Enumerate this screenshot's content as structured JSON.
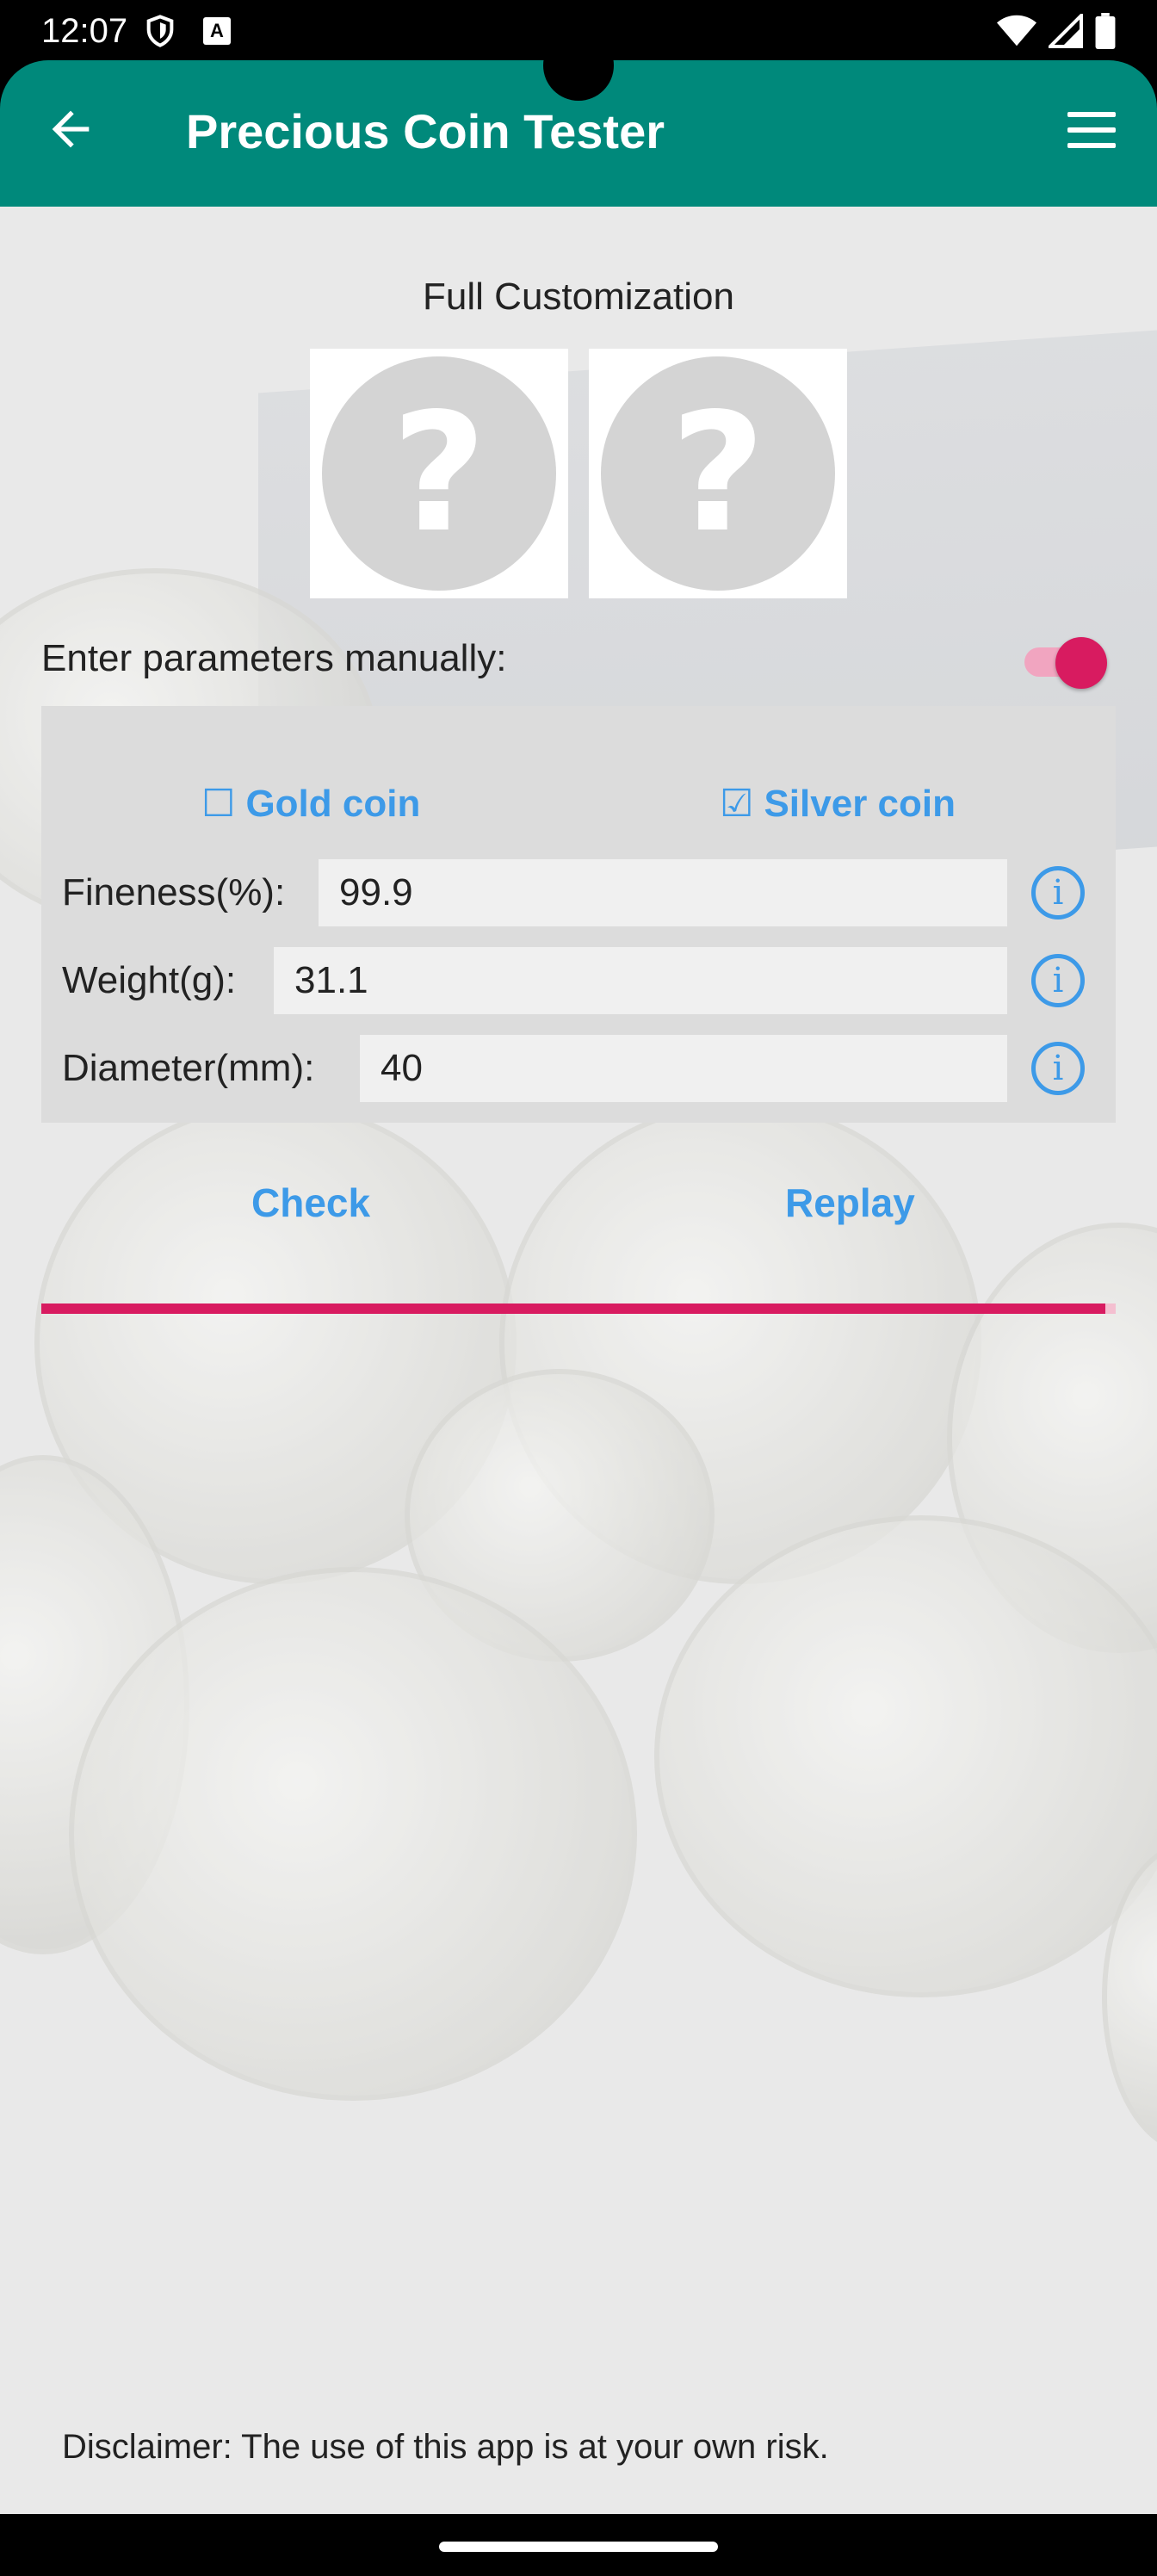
{
  "status_bar": {
    "time": "12:07",
    "keyboard_badge": "A"
  },
  "app_bar": {
    "title": "Precious Coin Tester",
    "accent_color": "#00897B"
  },
  "section": {
    "title": "Full Customization"
  },
  "coin_images": [
    {
      "glyph": "?"
    },
    {
      "glyph": "?"
    }
  ],
  "manual": {
    "label": "Enter parameters manually:",
    "enabled": true
  },
  "coin_types": {
    "gold": {
      "label": "Gold coin",
      "checkbox": "☐",
      "checked": false
    },
    "silver": {
      "label": "Silver coin",
      "checkbox": "☑",
      "checked": true
    }
  },
  "fields": {
    "fineness": {
      "label": "Fineness(%):",
      "value": "99.9"
    },
    "weight": {
      "label": "Weight(g):",
      "value": "31.1"
    },
    "diameter": {
      "label": "Diameter(mm):",
      "value": "40"
    }
  },
  "actions": {
    "check": "Check",
    "replay": "Replay"
  },
  "progress": {
    "fraction": 0.99,
    "color": "#d81b60"
  },
  "disclaimer": "Disclaimer: The use of this app is at your own risk."
}
